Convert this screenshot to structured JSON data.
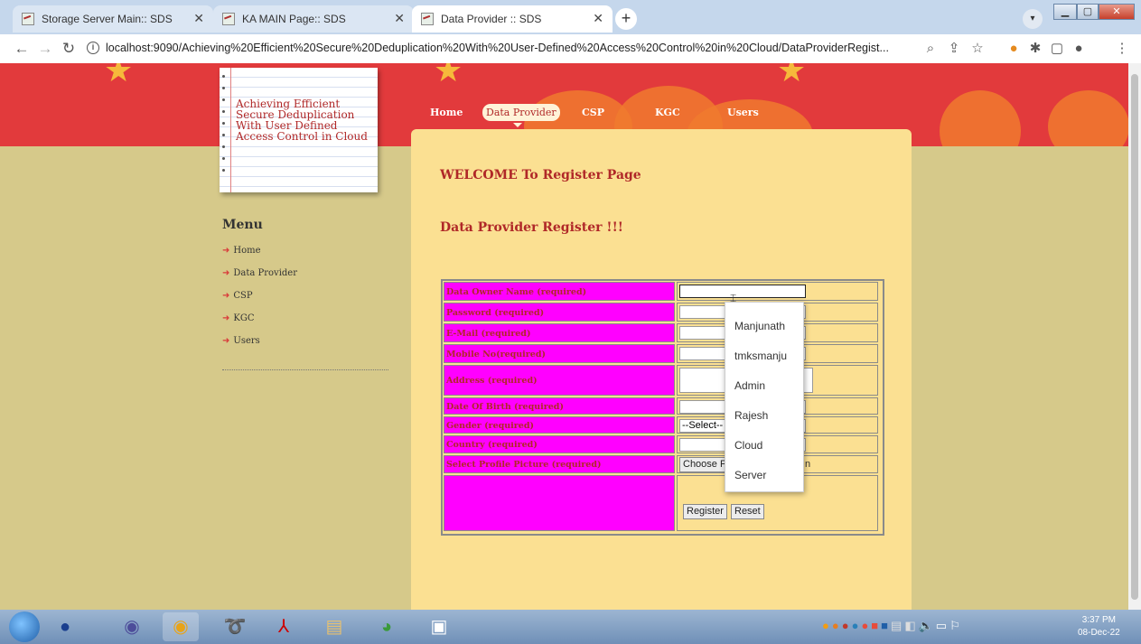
{
  "browser": {
    "tabs": [
      {
        "title": "Storage Server Main:: SDS",
        "active": false
      },
      {
        "title": "KA MAIN Page:: SDS",
        "active": false
      },
      {
        "title": "Data Provider :: SDS",
        "active": true
      }
    ],
    "url": "localhost:9090/Achieving%20Efficient%20Secure%20Deduplication%20With%20User-Defined%20Access%20Control%20in%20Cloud/DataProviderRegist..."
  },
  "site": {
    "logo_lines": [
      "Achieving Efficient",
      "Secure Deduplication",
      "With User Defined",
      "Access Control in Cloud"
    ],
    "nav": [
      "Home",
      "Data Provider",
      "CSP",
      "KGC",
      "Users"
    ],
    "menu_title": "Menu",
    "menu": [
      "Home",
      "Data Provider",
      "CSP",
      "KGC",
      "Users"
    ]
  },
  "main": {
    "welcome": "WELCOME To Register Page",
    "subtitle": "Data Provider Register !!!"
  },
  "form": {
    "labels": {
      "name": "Data Owner Name (required)",
      "password": "Password (required)",
      "email": "E-Mail (required)",
      "mobile": "Mobile No(required)",
      "address": "Address (required)",
      "dob": "Date Of Birth (required)",
      "gender": "Gender (required)",
      "country": "Country (required)",
      "picture": "Select Profile Picture (required)"
    },
    "gender_selected": "--Select--",
    "choose_file_visible": "Choose F",
    "file_status_visible": "n",
    "register_label": "Register",
    "reset_label": "Reset"
  },
  "autocomplete": [
    "Manjunath",
    "tmksmanju",
    "Admin",
    "Rajesh",
    "Cloud",
    "Server"
  ],
  "taskbar": {
    "time": "3:37 PM",
    "date": "08-Dec-22"
  },
  "colors": {
    "banner": "#e23a3c",
    "content_bg": "#fbe092",
    "page_bg": "#d6c98a",
    "label_bg": "#ff00ff",
    "heading": "#b02828"
  }
}
